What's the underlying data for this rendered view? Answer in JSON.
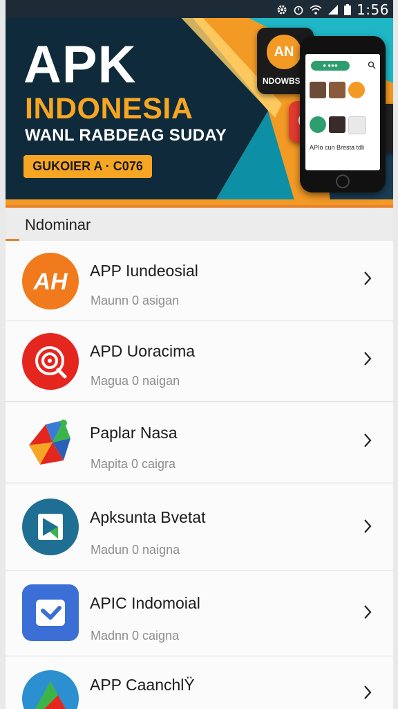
{
  "status_bar": {
    "time": "1:56",
    "icons": [
      "settings-icon",
      "alarm-icon",
      "wifi-icon",
      "signal-icon",
      "battery-icon"
    ]
  },
  "banner": {
    "title": "APK",
    "subtitle": "INDONESIA",
    "tagline": "WANL RABDEAG SUDAY",
    "badge": "GUKOIER A · C076",
    "phone_pill": "● ●●●",
    "phone_caption": "APIo cun Bresta tdli",
    "float_app_label": "NDOWBS",
    "float_app_logo": "AN",
    "colors": {
      "accent": "#f6a623",
      "bg": "#0f2a3a",
      "teal": "#1fb6c6"
    }
  },
  "section": {
    "title": "Ndominar",
    "accent_color": "#e8822e"
  },
  "apps": [
    {
      "name": "APP Iundeosial",
      "subtitle": "Maunn 0 asigan",
      "icon": "ah-logo-icon",
      "icon_text": "AH",
      "color": "#f07a1c"
    },
    {
      "name": "APD Uoracima",
      "subtitle": "Magua 0 naigan",
      "icon": "spiral-lens-icon",
      "color": "#e5261e"
    },
    {
      "name": "Paplar Nasa",
      "subtitle": "Mapita 0 caigra",
      "icon": "colorful-puzzle-icon",
      "color": "#3a7bd5"
    },
    {
      "name": "Apksunta Bvetat",
      "subtitle": "Madun 0 naigna",
      "icon": "play-music-icon",
      "color": "#1f6f95"
    },
    {
      "name": "APIC Indomoial",
      "subtitle": "Madnn 0 caigna",
      "icon": "checkmark-badge-icon",
      "color": "#3b6fd6"
    },
    {
      "name": "APP CaanchlŸ",
      "subtitle": "",
      "icon": "triangle-logo-icon",
      "color": "#2b8fd0"
    }
  ]
}
